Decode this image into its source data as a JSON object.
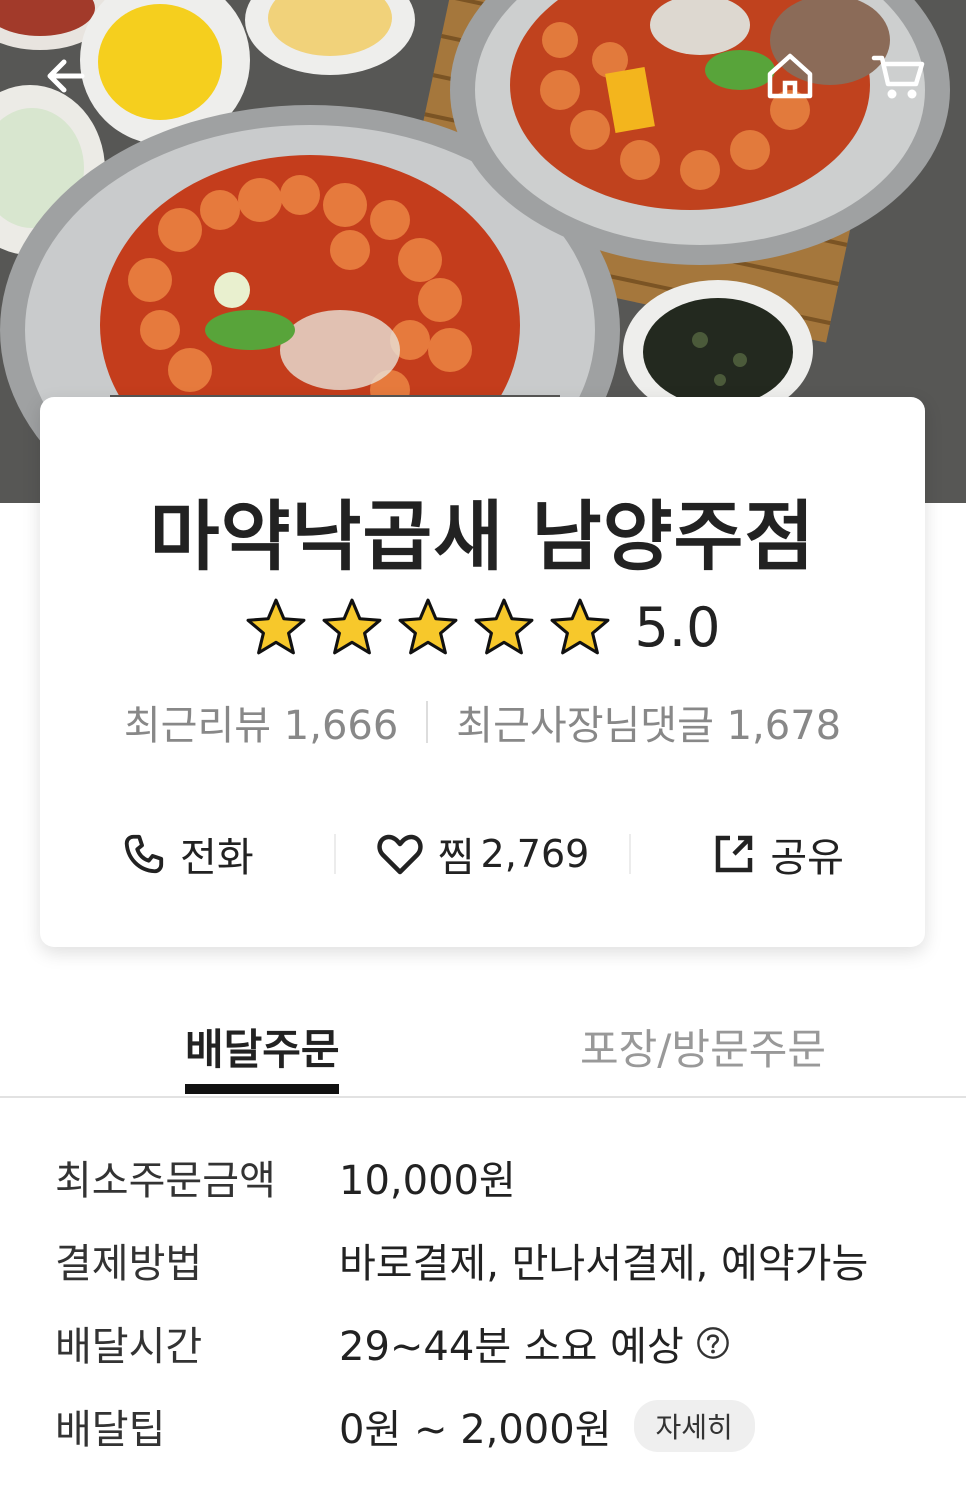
{
  "store": {
    "name": "마약낙곱새 남양주점",
    "rating": "5.0",
    "stars_filled": 5,
    "stars_total": 5,
    "recent_reviews": "최근리뷰 1,666",
    "owner_replies": "최근사장님댓글 1,678"
  },
  "actions": {
    "call": "전화",
    "like_label": "찜",
    "like_count": "2,769",
    "share": "공유"
  },
  "tabs": [
    {
      "label": "배달주문",
      "active": true
    },
    {
      "label": "포장/방문주문",
      "active": false
    }
  ],
  "details": {
    "min_order_label": "최소주문금액",
    "min_order_value": "10,000원",
    "payment_label": "결제방법",
    "payment_value": "바로결제, 만나서결제, 예약가능",
    "delivery_time_label": "배달시간",
    "delivery_time_value": "29~44분 소요 예상",
    "delivery_tip_label": "배달팁",
    "delivery_tip_value": "0원 ~ 2,000원",
    "detail_button": "자세히"
  },
  "icons": {
    "back": "arrow-left-icon",
    "home": "home-icon",
    "cart": "cart-icon",
    "star": "star-icon",
    "phone": "phone-icon",
    "heart": "heart-icon",
    "share": "share-icon",
    "help": "question-circle-icon"
  },
  "colors": {
    "star_fill": "#f7c82b",
    "text_primary": "#222222",
    "text_secondary": "#888888",
    "tab_indicator": "#111111",
    "chip_bg": "#efefef"
  }
}
